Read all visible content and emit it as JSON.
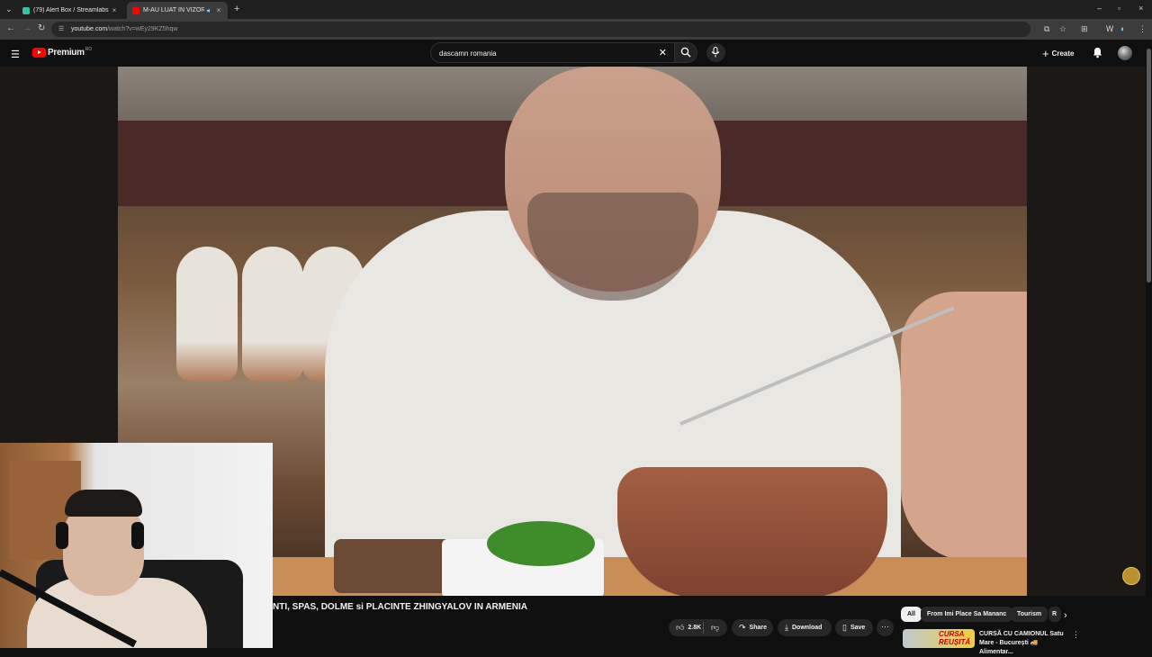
{
  "browser": {
    "tabs": [
      {
        "label": "(79) Alert Box / Streamlabs",
        "close": "×"
      },
      {
        "label": "M-AU LUAT IN VIZOR si P",
        "close": "×"
      }
    ],
    "new_tab": "+",
    "url_host": "youtube.com",
    "url_path": "/watch?v=wEy29KZ5hqw",
    "window_controls": [
      "–",
      "▫",
      "×"
    ]
  },
  "youtube": {
    "logo_text": "Premium",
    "country_code": "RO",
    "search_value": "dascamn romania",
    "clear": "✕",
    "create_label": "Create",
    "create_plus": "+"
  },
  "video": {
    "title": "NTI, SPAS, DOLME si PLACINTE ZHINGYALOV IN ARMENIA",
    "like_count": "2.8K",
    "share_label": "Share",
    "download_label": "Download",
    "save_label": "Save",
    "more": "···"
  },
  "chips": [
    "All",
    "From Imi Place Sa Mananc",
    "Tourism",
    "R"
  ],
  "recommendation": {
    "thumb_text": "CURSA REUȘITĂ",
    "title": "CURSĂ CU CAMIONUL Satu Mare - București 🚚 Alimentar...",
    "more": "⋮"
  },
  "colors": {
    "yt_red": "#ff0000",
    "background": "#0f0f0f",
    "chip_bg": "#272727"
  }
}
